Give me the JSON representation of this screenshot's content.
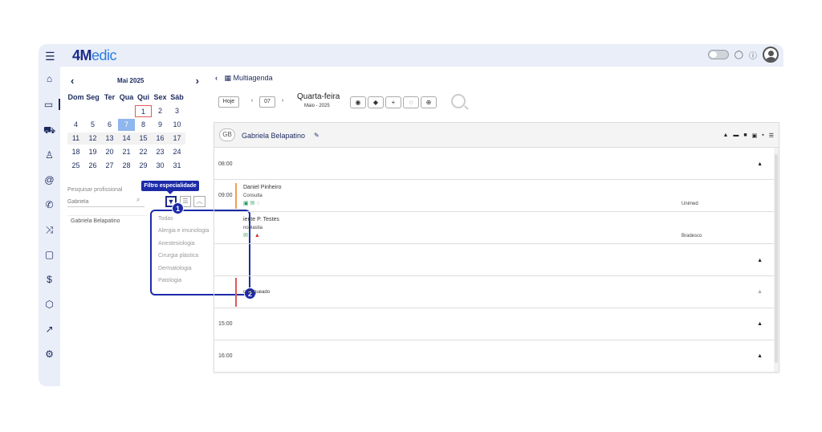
{
  "app": {
    "logo_4": "4",
    "logo_m": "M",
    "logo_rest": "edic"
  },
  "calendar": {
    "month": "Mai 2025",
    "days_header": [
      "Dom",
      "Seg",
      "Ter",
      "Qua",
      "Qui",
      "Sex",
      "Sáb"
    ],
    "weeks": [
      [
        "",
        "",
        "",
        "",
        "1",
        "2",
        "3"
      ],
      [
        "4",
        "5",
        "6",
        "7",
        "8",
        "9",
        "10"
      ],
      [
        "11",
        "12",
        "13",
        "14",
        "15",
        "16",
        "17"
      ],
      [
        "18",
        "19",
        "20",
        "21",
        "22",
        "23",
        "24"
      ],
      [
        "25",
        "26",
        "27",
        "28",
        "29",
        "30",
        "31"
      ]
    ],
    "today": "1",
    "selected": "7"
  },
  "search": {
    "label": "Pesquisar profissional",
    "value": "Gabriela",
    "tooltip": "Filtro especialidade",
    "result": "Gabriela Belapatino"
  },
  "filter_menu": {
    "items": [
      "Todas",
      "Alergia e imunologia",
      "Anestesiologia",
      "Cirurgia plástica",
      "Dermatologia",
      "Patologia"
    ],
    "badge_1": "1",
    "badge_2": "2"
  },
  "main": {
    "title": "Multiagenda",
    "today_button": "Hoje",
    "day_number": "07",
    "weekday": "Quarta-feira",
    "month_year": "Maio - 2025"
  },
  "agenda": {
    "initials": "GB",
    "professional": "Gabriela Belapatino",
    "slots": [
      {
        "time": "08:00"
      },
      {
        "time": "09:00",
        "patient": "Daniel Pinheiro",
        "type": "Consulta",
        "insurance": "Unimed"
      },
      {
        "time": "",
        "patient": "iente P. Testes",
        "type": "noplastia",
        "insurance": "Bradesco"
      },
      {
        "time": ""
      },
      {
        "time": "",
        "blocked": "o bloqueado"
      },
      {
        "time": "15:00"
      },
      {
        "time": "16:00"
      }
    ]
  },
  "colors": {
    "brand": "#1c2a8a",
    "accent": "#2c7be5",
    "selected_day": "#8fb6ee",
    "highlight": "#1c2aa8"
  }
}
